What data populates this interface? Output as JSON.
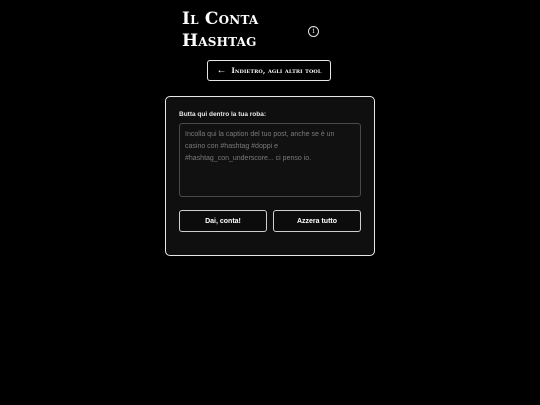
{
  "header": {
    "title_line1": "Il Conta",
    "title_line2": "Hashtag",
    "info_icon_glyph": "i",
    "info_icon_name": "info-icon"
  },
  "back_button": {
    "arrow_glyph": "←",
    "arrow_icon_name": "arrow-left-icon",
    "label": "Indietro, agli altri tool"
  },
  "form": {
    "field_label": "Butta qui dentro la tua roba:",
    "caption_value": "",
    "caption_placeholder": "Incolla qui la caption del tuo post, anche se è un casino con #hashtag #doppi e #hashtag_con_underscore... ci penso io.",
    "count_button_label": "Dai, conta!",
    "reset_button_label": "Azzera tutto"
  },
  "colors": {
    "background": "#000000",
    "card_background": "#0f0f0f",
    "border": "#e8e8e8",
    "text": "#ffffff",
    "placeholder": "#7a7a7a"
  }
}
